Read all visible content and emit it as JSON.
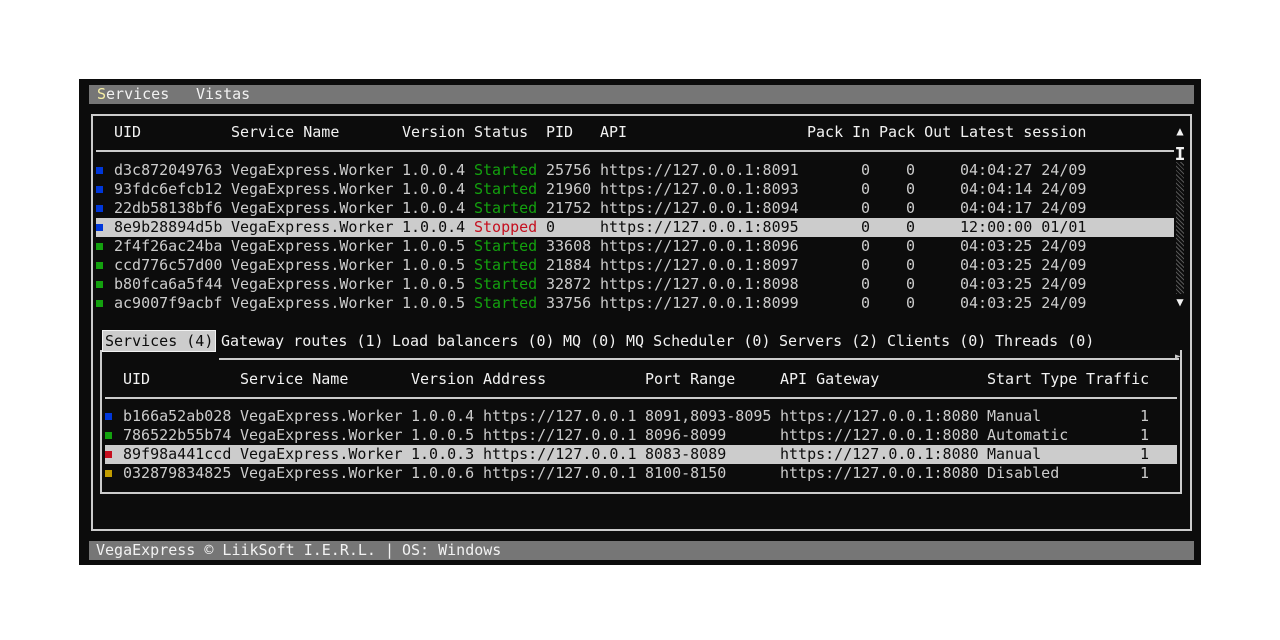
{
  "menu": {
    "services_first": "S",
    "services_rest": "ervices",
    "vistas": "Vistas"
  },
  "services_table": {
    "headers": [
      "UID",
      "Service Name",
      "Version",
      "Status",
      "PID",
      "API",
      "Pack In",
      "Pack Out",
      "Latest session"
    ],
    "rows": [
      {
        "color": "#0037da",
        "uid": "d3c872049763",
        "name": "VegaExpress.Worker",
        "version": "1.0.0.4",
        "status": "Started",
        "pid": "25756",
        "api": "https://127.0.0.1:8091",
        "pack_in": "0",
        "pack_out": "0",
        "session": "04:04:27 24/09"
      },
      {
        "color": "#0037da",
        "uid": "93fdc6efcb12",
        "name": "VegaExpress.Worker",
        "version": "1.0.0.4",
        "status": "Started",
        "pid": "21960",
        "api": "https://127.0.0.1:8093",
        "pack_in": "0",
        "pack_out": "0",
        "session": "04:04:14 24/09"
      },
      {
        "color": "#0037da",
        "uid": "22db58138bf6",
        "name": "VegaExpress.Worker",
        "version": "1.0.0.4",
        "status": "Started",
        "pid": "21752",
        "api": "https://127.0.0.1:8094",
        "pack_in": "0",
        "pack_out": "0",
        "session": "04:04:17 24/09"
      },
      {
        "color": "#0037da",
        "uid": "8e9b28894d5b",
        "name": "VegaExpress.Worker",
        "version": "1.0.0.4",
        "status": "Stopped",
        "pid": "0",
        "api": "https://127.0.0.1:8095",
        "pack_in": "0",
        "pack_out": "0",
        "session": "12:00:00 01/01"
      },
      {
        "color": "#13a10e",
        "uid": "2f4f26ac24ba",
        "name": "VegaExpress.Worker",
        "version": "1.0.0.5",
        "status": "Started",
        "pid": "33608",
        "api": "https://127.0.0.1:8096",
        "pack_in": "0",
        "pack_out": "0",
        "session": "04:03:25 24/09"
      },
      {
        "color": "#13a10e",
        "uid": "ccd776c57d00",
        "name": "VegaExpress.Worker",
        "version": "1.0.0.5",
        "status": "Started",
        "pid": "21884",
        "api": "https://127.0.0.1:8097",
        "pack_in": "0",
        "pack_out": "0",
        "session": "04:03:25 24/09"
      },
      {
        "color": "#13a10e",
        "uid": "b80fca6a5f44",
        "name": "VegaExpress.Worker",
        "version": "1.0.0.5",
        "status": "Started",
        "pid": "32872",
        "api": "https://127.0.0.1:8098",
        "pack_in": "0",
        "pack_out": "0",
        "session": "04:03:25 24/09"
      },
      {
        "color": "#13a10e",
        "uid": "ac9007f9acbf",
        "name": "VegaExpress.Worker",
        "version": "1.0.0.5",
        "status": "Started",
        "pid": "33756",
        "api": "https://127.0.0.1:8099",
        "pack_in": "0",
        "pack_out": "0",
        "session": "04:03:25 24/09"
      }
    ],
    "selected_index": 3
  },
  "tabs": [
    "Services (4)",
    "Gateway routes (1)",
    "Load balancers (0)",
    "MQ (0)",
    "MQ Scheduler (0)",
    "Servers (2)",
    "Clients (0)",
    "Threads (0)"
  ],
  "routes_table": {
    "headers": [
      "UID",
      "Service Name",
      "Version",
      "Address",
      "Port Range",
      "API Gateway",
      "Start Type",
      "Traffic"
    ],
    "rows": [
      {
        "color": "#0037da",
        "uid": "b166a52ab028",
        "name": "VegaExpress.Worker",
        "version": "1.0.0.4",
        "address": "https://127.0.0.1",
        "ports": "8091,8093-8095",
        "gateway": "https://127.0.0.1:8080",
        "start": "Manual",
        "traffic": "1"
      },
      {
        "color": "#13a10e",
        "uid": "786522b55b74",
        "name": "VegaExpress.Worker",
        "version": "1.0.0.5",
        "address": "https://127.0.0.1",
        "ports": "8096-8099",
        "gateway": "https://127.0.0.1:8080",
        "start": "Automatic",
        "traffic": "1"
      },
      {
        "color": "#c50f1f",
        "uid": "89f98a441ccd",
        "name": "VegaExpress.Worker",
        "version": "1.0.0.3",
        "address": "https://127.0.0.1",
        "ports": "8083-8089",
        "gateway": "https://127.0.0.1:8080",
        "start": "Manual",
        "traffic": "1"
      },
      {
        "color": "#c19c00",
        "uid": "032879834825",
        "name": "VegaExpress.Worker",
        "version": "1.0.0.6",
        "address": "https://127.0.0.1",
        "ports": "8100-8150",
        "gateway": "https://127.0.0.1:8080",
        "start": "Disabled",
        "traffic": "1"
      }
    ],
    "selected_index": 2
  },
  "status": {
    "copyright": "VegaExpress © LiikSoft I.E.R.L.",
    "separator": "|",
    "os": "OS: Windows"
  },
  "icons": {
    "scroll_up": "▲",
    "scroll_down": "▼",
    "thumb": "I",
    "tab_arrow": "►"
  }
}
